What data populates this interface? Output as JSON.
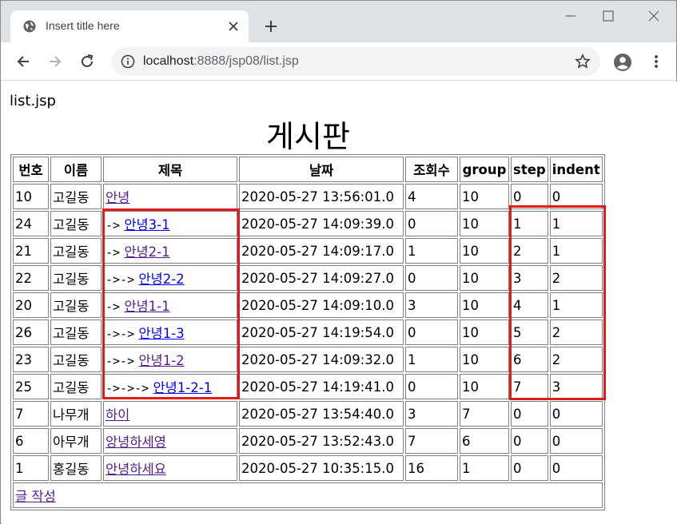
{
  "browser": {
    "tab_title": "Insert title here",
    "url_host": "localhost",
    "url_rest": ":8888/jsp08/list.jsp"
  },
  "page": {
    "filename": "list.jsp",
    "heading": "게시판",
    "write_link": "글 작성"
  },
  "table": {
    "headers": [
      "번호",
      "이름",
      "제목",
      "날짜",
      "조회수",
      "group",
      "step",
      "indent"
    ],
    "rows": [
      {
        "no": "10",
        "name": "고길동",
        "arrow": "",
        "title": "안녕",
        "date": "2020-05-27 13:56:01.0",
        "hit": "4",
        "group": "10",
        "step": "0",
        "indent": "0"
      },
      {
        "no": "24",
        "name": "고길동",
        "arrow": "->",
        "title": "안녕3-1",
        "date": "2020-05-27 14:09:39.0",
        "hit": "0",
        "group": "10",
        "step": "1",
        "indent": "1"
      },
      {
        "no": "21",
        "name": "고길동",
        "arrow": "->",
        "title": "안녕2-1",
        "date": "2020-05-27 14:09:17.0",
        "hit": "1",
        "group": "10",
        "step": "2",
        "indent": "1"
      },
      {
        "no": "22",
        "name": "고길동",
        "arrow": "->->",
        "title": "안녕2-2",
        "date": "2020-05-27 14:09:27.0",
        "hit": "0",
        "group": "10",
        "step": "3",
        "indent": "2"
      },
      {
        "no": "20",
        "name": "고길동",
        "arrow": "->",
        "title": "안녕1-1",
        "date": "2020-05-27 14:09:10.0",
        "hit": "3",
        "group": "10",
        "step": "4",
        "indent": "1"
      },
      {
        "no": "26",
        "name": "고길동",
        "arrow": "->->",
        "title": "안녕1-3",
        "date": "2020-05-27 14:19:54.0",
        "hit": "0",
        "group": "10",
        "step": "5",
        "indent": "2"
      },
      {
        "no": "23",
        "name": "고길동",
        "arrow": "->->",
        "title": "안녕1-2",
        "date": "2020-05-27 14:09:32.0",
        "hit": "1",
        "group": "10",
        "step": "6",
        "indent": "2"
      },
      {
        "no": "25",
        "name": "고길동",
        "arrow": "->->->",
        "title": "안녕1-2-1",
        "date": "2020-05-27 14:19:41.0",
        "hit": "0",
        "group": "10",
        "step": "7",
        "indent": "3"
      },
      {
        "no": "7",
        "name": "나무개",
        "arrow": "",
        "title": "하이",
        "date": "2020-05-27 13:54:40.0",
        "hit": "3",
        "group": "7",
        "step": "0",
        "indent": "0"
      },
      {
        "no": "6",
        "name": "아무개",
        "arrow": "",
        "title": "앙녕하세영",
        "date": "2020-05-27 13:52:43.0",
        "hit": "7",
        "group": "6",
        "step": "0",
        "indent": "0"
      },
      {
        "no": "1",
        "name": "홍길동",
        "arrow": "",
        "title": "안녕하세요",
        "date": "2020-05-27 10:35:15.0",
        "hit": "16",
        "group": "1",
        "step": "0",
        "indent": "0"
      }
    ]
  },
  "colors": {
    "highlight": "#e01b1b",
    "visited_link": "#551a8b",
    "unvisited_link": "#0000ee"
  }
}
